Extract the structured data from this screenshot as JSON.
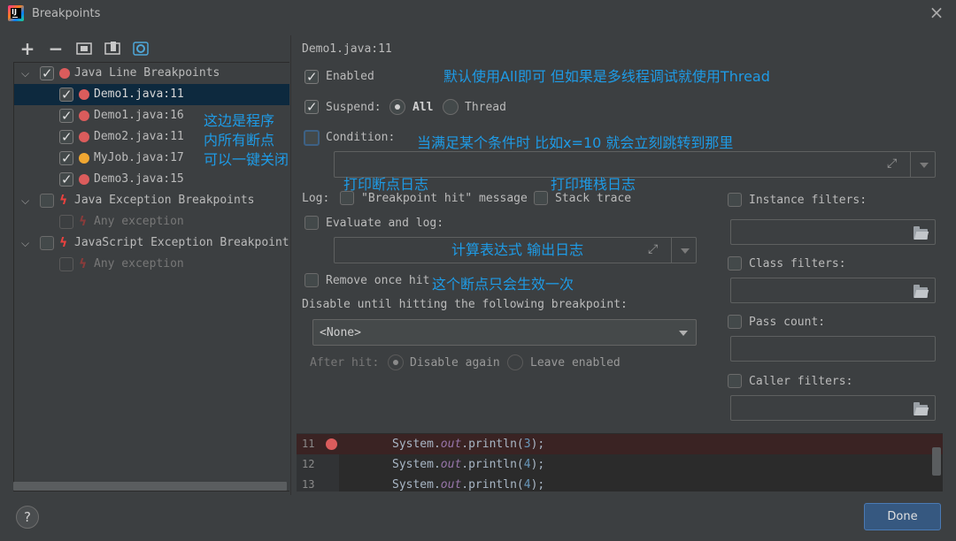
{
  "window": {
    "title": "Breakpoints",
    "close_icon": "×"
  },
  "toolbar": {
    "add": "+",
    "remove": "−"
  },
  "tree": {
    "groups": [
      {
        "label": "Java Line Breakpoints",
        "checked": true
      },
      {
        "label": "Java Exception Breakpoints",
        "checked": false
      },
      {
        "label": "JavaScript Exception Breakpoints",
        "checked": false
      }
    ],
    "items": [
      {
        "label": "Demo1.java:11"
      },
      {
        "label": "Demo1.java:16"
      },
      {
        "label": "Demo2.java:11"
      },
      {
        "label": "MyJob.java:17"
      },
      {
        "label": "Demo3.java:15"
      }
    ],
    "any_exception_1": "Any exception",
    "any_exception_2": "Any exception"
  },
  "details": {
    "header": "Demo1.java:11",
    "enabled": "Enabled",
    "suspend": "Suspend:",
    "all": "All",
    "thread": "Thread",
    "condition": "Condition:",
    "log": "Log:",
    "log_message": "\"Breakpoint hit\" message",
    "stack_trace": "Stack trace",
    "evaluate_and_log": "Evaluate and log:",
    "remove_once_hit": "Remove once hit",
    "disable_until": "Disable until hitting the following breakpoint:",
    "none_option": "<None>",
    "after_hit": "After hit:",
    "disable_again": "Disable again",
    "leave_enabled": "Leave enabled",
    "instance_filters": "Instance filters:",
    "class_filters": "Class filters:",
    "pass_count": "Pass count:",
    "caller_filters": "Caller filters:"
  },
  "annotations": {
    "enabled_note": "默认使用All即可  但如果是多线程调试就使用Thread",
    "tree_note_1": "这边是程序",
    "tree_note_2": "内所有断点",
    "tree_note_3": "可以一键关闭",
    "condition_note": "当满足某个条件时 比如x=10 就会立刻跳转到那里",
    "log_note": "打印断点日志",
    "stack_note": "打印堆栈日志",
    "evaluate_note": "计算表达式 输出日志",
    "remove_note": "这个断点只会生效一次"
  },
  "code": {
    "lines": [
      {
        "num": "11",
        "prefix": "System.",
        "field": "out",
        "mid": ".println(",
        "arg": "3",
        "suffix": ");"
      },
      {
        "num": "12",
        "prefix": "System.",
        "field": "out",
        "mid": ".println(",
        "arg": "4",
        "suffix": ");"
      },
      {
        "num": "13",
        "prefix": "System.",
        "field": "out",
        "mid": ".println(",
        "arg": "4",
        "suffix": ");"
      }
    ]
  },
  "footer": {
    "help": "?",
    "done": "Done"
  },
  "colors": {
    "accent": "#1e9be6",
    "breakpoint": "#db5c5c",
    "done_button": "#365880"
  }
}
